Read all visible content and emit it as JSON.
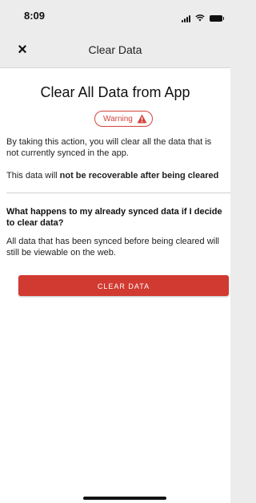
{
  "status_bar": {
    "time": "8:09",
    "icons": [
      "signal-icon",
      "wifi-icon",
      "battery-icon"
    ]
  },
  "nav": {
    "close_icon": "close-icon",
    "close_glyph": "×",
    "title": "Clear Data"
  },
  "main": {
    "heading": "Clear All Data from App",
    "warning_label": "Warning",
    "warning_color": "#d2453d",
    "paragraph1": "By taking this action, you will clear all the data that is not currently synced in the app.",
    "paragraph2_prefix": "This data will ",
    "paragraph2_bold": "not be recoverable after being cleared",
    "question": "What happens to my already synced data if I decide to clear data?",
    "answer": "All data that has been synced before being cleared will still be viewable on the web.",
    "button_label": "CLEAR DATA",
    "button_color": "#d13a31"
  }
}
